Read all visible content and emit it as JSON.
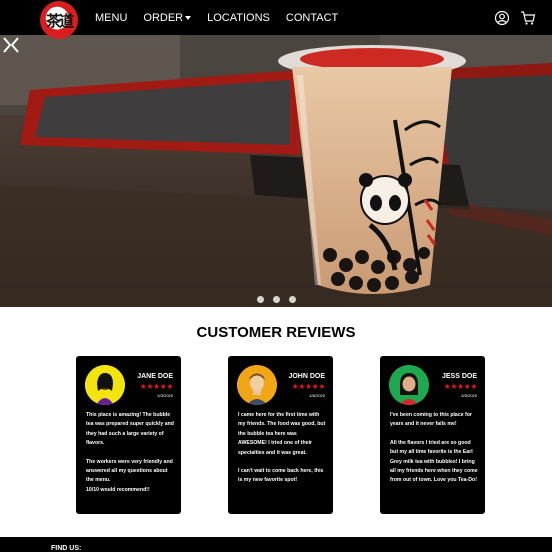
{
  "nav": {
    "links": [
      {
        "label": "MENU",
        "has_caret": false
      },
      {
        "label": "ORDER",
        "has_caret": true
      },
      {
        "label": "LOCATIONS",
        "has_caret": false
      },
      {
        "label": "CONTACT",
        "has_caret": false
      }
    ],
    "icons": [
      "user-icon",
      "cart-icon"
    ]
  },
  "hero": {
    "slides_count": 3,
    "active_slide": 1
  },
  "reviews": {
    "title": "CUSTOMER REVIEWS",
    "cards": [
      {
        "name": "JANE DOE",
        "rating": 5,
        "date": "5/3/2020",
        "avatar_color": "#f2e50f",
        "paragraphs": [
          "This place is amazing! The bubble tea was prepared super quickly and they had such a large variety of flavors.",
          "The workers were very friendly and answered all my questions about the menu.",
          "10/10 would recommend!!"
        ]
      },
      {
        "name": "JOHN DOE",
        "rating": 5,
        "date": "4/6/2020",
        "avatar_color": "#f1a616",
        "paragraphs": [
          "I came here for the first time with my friends. The food was good, but the bubble tea here was AWESOME! I tried one of their specialties and it was great.",
          "I can't wait to come back here, this is my new favorite spot!"
        ]
      },
      {
        "name": "JESS DOE",
        "rating": 5,
        "date": "6/5/2020",
        "avatar_color": "#1ea850",
        "paragraphs": [
          "I've been coming to this place for years and it never fails me!",
          "All the flavors I tried are so good but my all time favorite is the Earl Grey milk tea with bubbles! I bring all my friends here when they come from out of town. Love you Tea-Do!"
        ]
      }
    ]
  },
  "footer": {
    "label": "FIND US:"
  }
}
